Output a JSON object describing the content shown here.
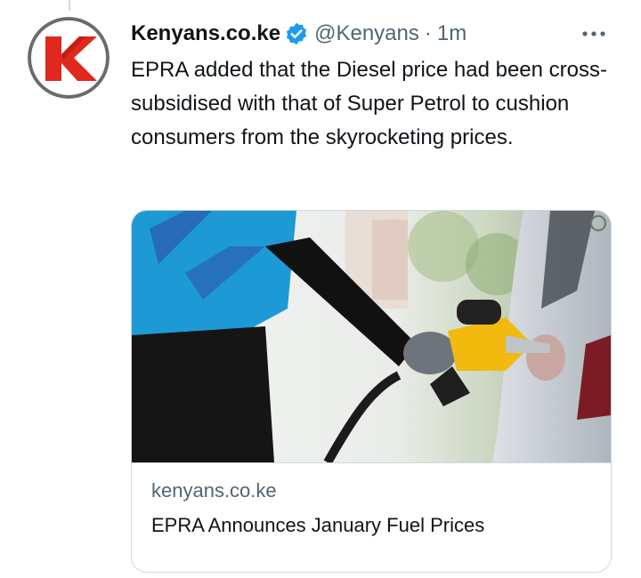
{
  "tweet": {
    "display_name": "Kenyans.co.ke",
    "handle": "@Kenyans",
    "separator": "·",
    "time": "1m",
    "text": "EPRA added that the Diesel price had been cross-subsidised with that of Super Petrol to cushion consumers from the skyrocketing prices.",
    "avatar_letter": "K"
  },
  "card": {
    "domain": "kenyans.co.ke",
    "title": "EPRA Announces January Fuel Prices",
    "image_icon": "fuel-pump-photo"
  },
  "icons": {
    "verified": "verified-badge-icon",
    "more": "more-options-icon"
  },
  "colors": {
    "verified": "#1d9bf0",
    "brand_red": "#e0281e",
    "text_primary": "#0f1419",
    "text_secondary": "#536471",
    "border": "#cfd9de"
  }
}
